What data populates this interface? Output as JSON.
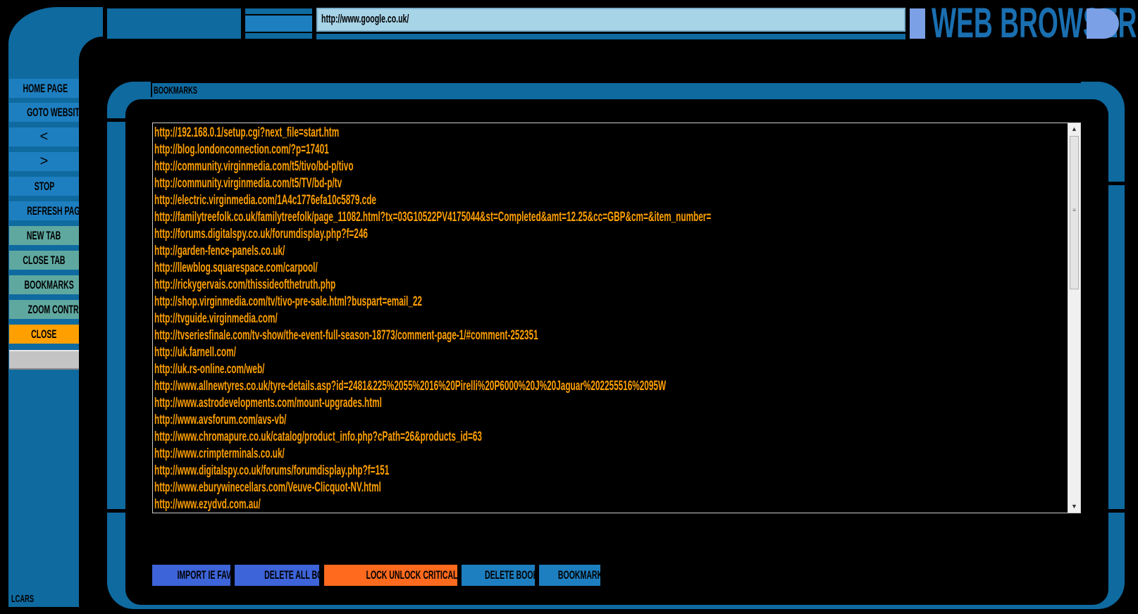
{
  "address_bar": {
    "url": "http://www.google.co.uk/"
  },
  "app_title": "WEB BROWSER",
  "lcars_label": "LCARS",
  "nav": {
    "home_page": "HOME PAGE",
    "goto_website": "GOTO WEBSITE",
    "back": "<",
    "forward": ">",
    "stop": "STOP",
    "refresh_page": "REFRESH PAGE",
    "new_tab": "NEW TAB",
    "close_tab": "CLOSE TAB",
    "bookmarks": "BOOKMARKS",
    "zoom_control": "ZOOM CONTROL",
    "close": "CLOSE"
  },
  "bookmarks_panel": {
    "title": "BOOKMARKS",
    "items": [
      "http://192.168.0.1/setup.cgi?next_file=start.htm",
      "http://blog.londonconnection.com/?p=17401",
      "http://community.virginmedia.com/t5/tivo/bd-p/tivo",
      "http://community.virginmedia.com/t5/TV/bd-p/tv",
      "http://electric.virginmedia.com/1A4c1776efa10c5879.cde",
      "http://familytreefolk.co.uk/familytreefolk/page_11082.html?tx=03G10522PV4175044&st=Completed&amt=12.25&cc=GBP&cm=&item_number=",
      "http://forums.digitalspy.co.uk/forumdisplay.php?f=246",
      "http://garden-fence-panels.co.uk/",
      "http://llewblog.squarespace.com/carpool/",
      "http://rickygervais.com/thissideofthetruth.php",
      "http://shop.virginmedia.com/tv/tivo-pre-sale.html?buspart=email_22",
      "http://tvguide.virginmedia.com/",
      "http://tvseriesfinale.com/tv-show/the-event-full-season-18773/comment-page-1/#comment-252351",
      "http://uk.farnell.com/",
      "http://uk.rs-online.com/web/",
      "http://www.allnewtyres.co.uk/tyre-details.asp?id=2481&225%2055%2016%20Pirelli%20P6000%20J%20Jaguar%202255516%2095W",
      "http://www.astrodevelopments.com/mount-upgrades.html",
      "http://www.avsforum.com/avs-vb/",
      "http://www.chromapure.co.uk/catalog/product_info.php?cPath=26&products_id=63",
      "http://www.crimpterminals.co.uk/",
      "http://www.digitalspy.co.uk/forums/forumdisplay.php?f=151",
      "http://www.eburywinecellars.com/Veuve-Clicquot-NV.html",
      "http://www.ezydvd.com.au/"
    ]
  },
  "actions": {
    "import_ie_favorites": "IMPORT IE FAVORITES",
    "delete_all_bookmarks": "DELETE ALL BOOKMARKS",
    "lock_unlock": "LOCK  UNLOCK CRITICAL FUNCTIONS",
    "delete_bookmark": "DELETE BOOKMARK",
    "bookmark_url": "BOOKMARK URL"
  },
  "colors": {
    "frame_blue": "#0f6aa0",
    "button_blue": "#1e7fc0",
    "button_teal": "#5fa8a0",
    "button_orange": "#ffa000",
    "lock_orange": "#ff6a1e",
    "royal_blue": "#3d64d8",
    "link_text": "#ffa000"
  }
}
